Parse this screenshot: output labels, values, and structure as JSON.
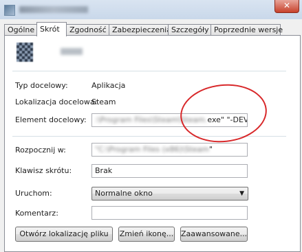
{
  "window": {
    "close_glyph": "✕"
  },
  "tabs": [
    {
      "label": "Ogólne"
    },
    {
      "label": "Skrót"
    },
    {
      "label": "Zgodność"
    },
    {
      "label": "Zabezpieczenia"
    },
    {
      "label": "Szczegóły"
    },
    {
      "label": "Poprzednie wersje"
    }
  ],
  "shortcut": {
    "target_type_label": "Typ docelowy:",
    "target_type_value": "Aplikacja",
    "target_location_label": "Lokalizacja docelowa:",
    "target_location_value": "Steam",
    "target_label": "Element docelowy:",
    "target_value_suffix": "exe\" \"-DEVMODE\"",
    "start_in_label": "Rozpocznij w:",
    "start_in_value_suffix": "\"",
    "hotkey_label": "Klawisz skrótu:",
    "hotkey_value": "Brak",
    "run_label": "Uruchom:",
    "run_value": "Normalne okno",
    "comment_label": "Komentarz:",
    "comment_value": ""
  },
  "buttons": {
    "open_location": "Otwórz lokalizację pliku",
    "change_icon": "Zmień ikonę...",
    "advanced": "Zaawansowane..."
  },
  "colors": {
    "annotation": "#d8282a",
    "close_button": "#c7412b"
  }
}
